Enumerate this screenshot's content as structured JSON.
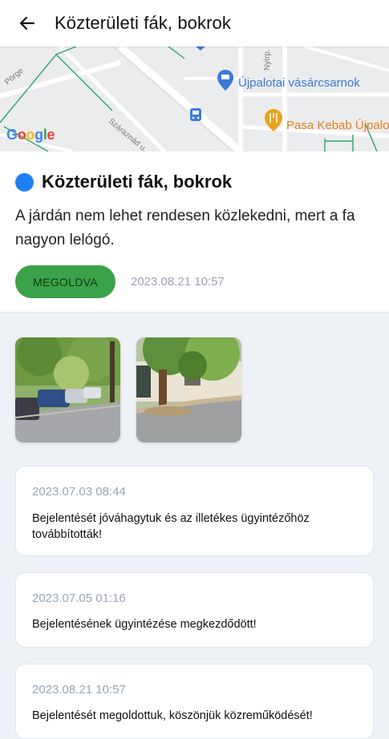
{
  "app_bar": {
    "title": "Közterületi fák, bokrok",
    "back_icon": "arrow-left-icon"
  },
  "map": {
    "poi_market": "Újpalotai vásárcsarnok",
    "poi_kebab": "Pasa Kebab Újpalo",
    "street_1": "Száraznád u.",
    "street_2": "Nyírp.",
    "street_3": "Pörge",
    "logo": "Google",
    "colors": {
      "background": "#ebecee",
      "road": "#ffffff",
      "path": "#2ea56b",
      "market_pin": "#3b7ad8",
      "food_pin": "#e8a21c"
    }
  },
  "report": {
    "title": "Közterületi fák, bokrok",
    "description": "A járdán nem lehet rendesen közlekedni, mert a fa nagyon lelógó.",
    "status": "MEGOLDVA",
    "date": "2023.08.21 10:57",
    "colors": {
      "status_dot": "#1e7ff2",
      "status_chip": "#3aa34a"
    }
  },
  "photos": [
    {
      "name": "photo-1",
      "subject": "street with parked cars under trees"
    },
    {
      "name": "photo-2",
      "subject": "tree on sidewalk in front of building"
    }
  ],
  "events": [
    {
      "date": "2023.07.03 08:44",
      "text": "Bejelentését jóváhagytuk és az illetékes ügyintézőhöz továbbították!"
    },
    {
      "date": "2023.07.05 01:16",
      "text": "Bejelentésének ügyintézése megkezdődött!"
    },
    {
      "date": "2023.08.21 10:57",
      "text": "Bejelentését megoldottuk, köszönjük közreműködését!"
    }
  ]
}
